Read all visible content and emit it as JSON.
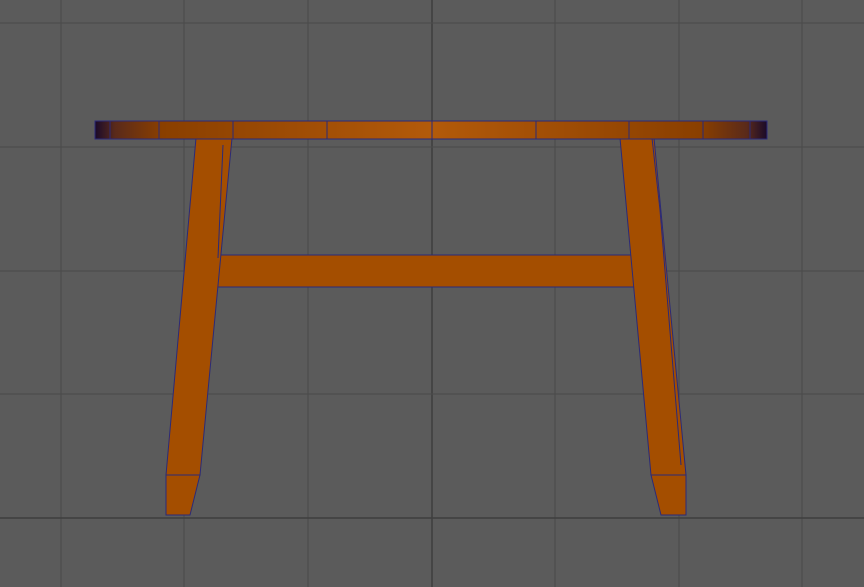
{
  "viewport": {
    "name": "front-orthographic-viewport"
  },
  "scene": {
    "object_name": "table-model"
  },
  "colors": {
    "background": "#5b5b5b",
    "grid_line": "#4a4a4a",
    "grid_axis": "#3c3c3c",
    "wood_main": "#a44e00",
    "wood_light": "#b35a0a",
    "wood_dark": "#8a3f00",
    "edge_wire": "#2b2a78",
    "shadow_end": "#1a0a2a"
  },
  "icons": {
    "model": "table-mesh-icon"
  }
}
